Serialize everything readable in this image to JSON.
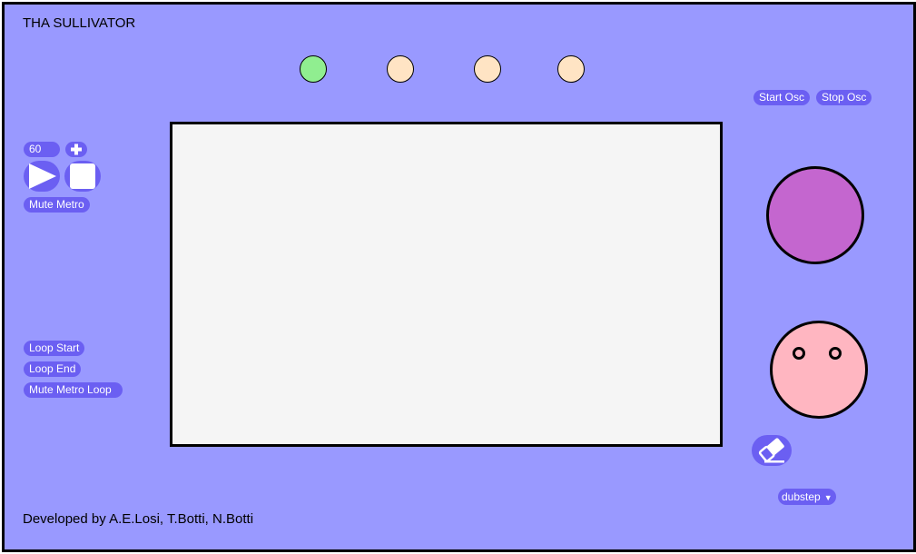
{
  "app": {
    "title": "THA SULLIVATOR",
    "footer": "Developed by A.E.Losi, T.Botti, N.Botti"
  },
  "indicators": [
    {
      "name": "beat-1",
      "color": "#90ee90"
    },
    {
      "name": "beat-2",
      "color": "#ffe4c4"
    },
    {
      "name": "beat-3",
      "color": "#ffe4c4"
    },
    {
      "name": "beat-4",
      "color": "#ffe4c4"
    }
  ],
  "metronome": {
    "bpm": "60",
    "increase_icon": "plus-icon",
    "play_icon": "play-icon",
    "stop_icon": "stop-icon",
    "mute_label": "Mute Metro"
  },
  "loop": {
    "start_label": "Loop Start",
    "end_label": "Loop End",
    "mute_label": "Mute Metro Loop"
  },
  "oscillator": {
    "start_label": "Start Osc",
    "stop_label": "Stop Osc"
  },
  "knob": {
    "color": "#c466cf"
  },
  "face": {
    "color": "#ffb6c1"
  },
  "eraser": {
    "icon": "eraser-icon"
  },
  "preset": {
    "selected": "dubstep"
  },
  "colors": {
    "background": "#9999ff",
    "accent": "#6b5ff2",
    "screen": "#f5f5f5"
  }
}
